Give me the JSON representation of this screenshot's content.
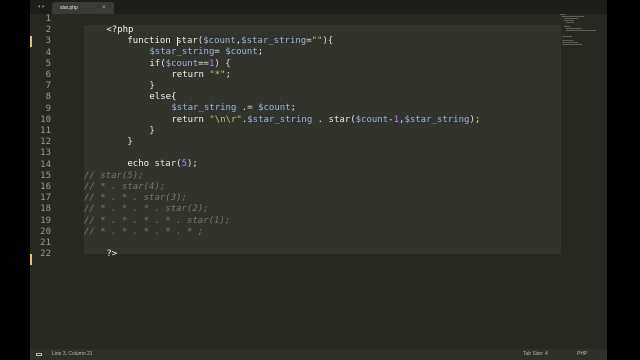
{
  "tab": {
    "title": "star.php",
    "close": "×"
  },
  "nav": {
    "arrows": "◂▸"
  },
  "line_numbers": [
    "1",
    "2",
    "3",
    "4",
    "5",
    "6",
    "7",
    "8",
    "9",
    "10",
    "11",
    "12",
    "13",
    "14",
    "15",
    "16",
    "17",
    "18",
    "19",
    "20",
    "21",
    "22"
  ],
  "code": {
    "l1": "<?php",
    "l2": {
      "kw": "function",
      "name": " star(",
      "v1": "$count",
      "c1": ",",
      "v2": "$star_string",
      "eq": "=",
      "s": "\"\"",
      "end": "){"
    },
    "l3": {
      "v1": "$star_string",
      "op": "= ",
      "v2": "$count",
      "end": ";"
    },
    "l4": {
      "kw": "if(",
      "v": "$count",
      "op": "==",
      "n": "1",
      "end": ") {"
    },
    "l5": {
      "kw": "return",
      "s": " \"*\"",
      "end": ";"
    },
    "l6": "}",
    "l7": "else{",
    "l8": {
      "v1": "$star_string",
      "op": " .= ",
      "v2": "$count",
      "end": ";"
    },
    "l9": {
      "kw": "return",
      "s": " \"\\n\\r\"",
      "dot": ".",
      "v1": "$star_string",
      "mid": " . star(",
      "v2": "$count",
      "minus": "-",
      "n": "1",
      "c": ",",
      "v3": "$star_string",
      "end": ");"
    },
    "l10": "}",
    "l11": "}",
    "l13": {
      "kw": "echo",
      "mid": " star(",
      "n": "5",
      "end": ");"
    },
    "l15": "// star(5);",
    "l16": "// * . star(4);",
    "l17": "// * . * . star(3);",
    "l18": "// * . * . * . star(2);",
    "l19": "// * . * . * . * . star(1);",
    "l20": "// * . * . * . * . * ;",
    "l21": "?>"
  },
  "status": {
    "position": "Line 3, Column 21",
    "tab_size": "Tab Size: 4",
    "syntax": "PHP"
  }
}
